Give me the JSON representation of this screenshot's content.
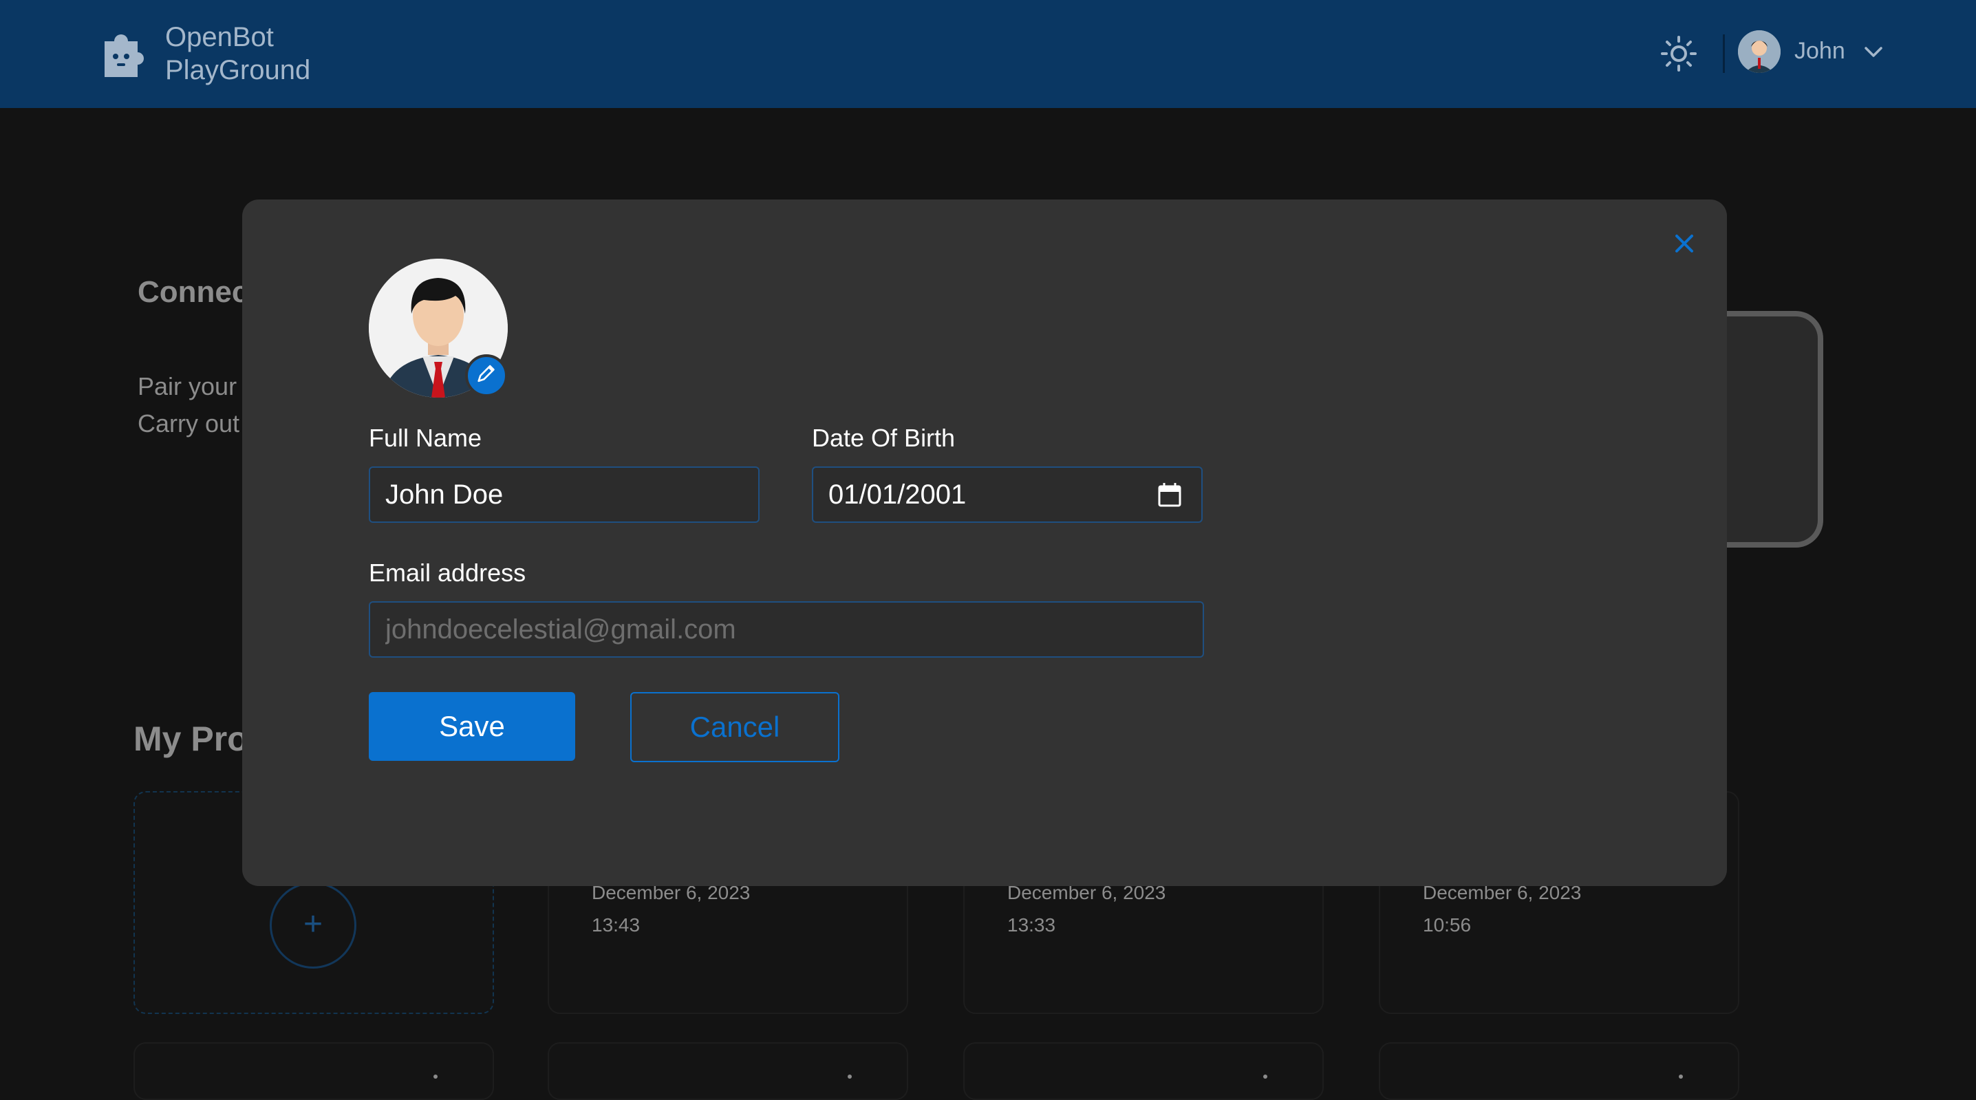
{
  "header": {
    "app_name_line1": "OpenBot",
    "app_name_line2": "PlayGround",
    "username": "John",
    "icons": [
      "logo-puzzle-icon",
      "sun-icon",
      "chevron-down-icon"
    ]
  },
  "background": {
    "connect_heading": "Connec",
    "connect_desc_line1": "Pair your",
    "connect_desc_line2": "Carry out",
    "projects_heading": "My Proj",
    "project_cards": [
      {
        "date": "December 6, 2023",
        "time": "13:43"
      },
      {
        "date": "December 6, 2023",
        "time": "13:33"
      },
      {
        "date": "December 6, 2023",
        "time": "10:56"
      }
    ],
    "add_symbol": "+"
  },
  "modal": {
    "full_name_label": "Full Name",
    "full_name_value": "John Doe",
    "dob_label": "Date Of Birth",
    "dob_value": "01/01/2001",
    "email_label": "Email address",
    "email_placeholder": "johndoecelestial@gmail.com",
    "save_label": "Save",
    "cancel_label": "Cancel",
    "icons": [
      "close-icon",
      "pencil-icon",
      "calendar-icon"
    ]
  },
  "colors": {
    "header_bg": "#0a3763",
    "accent": "#0a71cf",
    "modal_bg": "#333333",
    "page_bg": "#131313"
  }
}
